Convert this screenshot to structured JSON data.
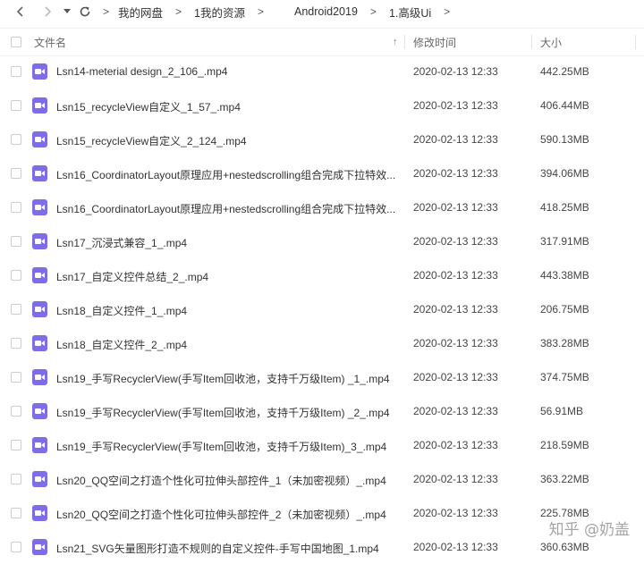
{
  "toolbar": {
    "breadcrumbs": [
      "我的网盘",
      "1我的资源",
      "Android2019",
      "1.高级Ui"
    ],
    "separator": ">"
  },
  "header": {
    "name": "文件名",
    "modified": "修改时间",
    "size": "大小"
  },
  "files": [
    {
      "name": "Lsn14-meterial design_2_106_.mp4",
      "date": "2020-02-13 12:33",
      "size": "442.25MB"
    },
    {
      "name": "Lsn15_recycleView自定义_1_57_.mp4",
      "date": "2020-02-13 12:33",
      "size": "406.44MB"
    },
    {
      "name": "Lsn15_recycleView自定义_2_124_.mp4",
      "date": "2020-02-13 12:33",
      "size": "590.13MB"
    },
    {
      "name": "Lsn16_CoordinatorLayout原理应用+nestedscrolling组合完成下拉特效...",
      "date": "2020-02-13 12:33",
      "size": "394.06MB"
    },
    {
      "name": "Lsn16_CoordinatorLayout原理应用+nestedscrolling组合完成下拉特效...",
      "date": "2020-02-13 12:33",
      "size": "418.25MB"
    },
    {
      "name": "Lsn17_沉浸式兼容_1_.mp4",
      "date": "2020-02-13 12:33",
      "size": "317.91MB"
    },
    {
      "name": "Lsn17_自定义控件总结_2_.mp4",
      "date": "2020-02-13 12:33",
      "size": "443.38MB"
    },
    {
      "name": "Lsn18_自定义控件_1_.mp4",
      "date": "2020-02-13 12:33",
      "size": "206.75MB"
    },
    {
      "name": "Lsn18_自定义控件_2_.mp4",
      "date": "2020-02-13 12:33",
      "size": "383.28MB"
    },
    {
      "name": "Lsn19_手写RecyclerView(手写Item回收池，支持千万级Item) _1_.mp4",
      "date": "2020-02-13 12:33",
      "size": "374.75MB"
    },
    {
      "name": "Lsn19_手写RecyclerView(手写Item回收池，支持千万级Item) _2_.mp4",
      "date": "2020-02-13 12:33",
      "size": "56.91MB"
    },
    {
      "name": "Lsn19_手写RecyclerView(手写Item回收池，支持千万级Item)_3_.mp4",
      "date": "2020-02-13 12:33",
      "size": "218.59MB"
    },
    {
      "name": "Lsn20_QQ空间之打造个性化可拉伸头部控件_1（未加密视频）_.mp4",
      "date": "2020-02-13 12:33",
      "size": "363.22MB"
    },
    {
      "name": "Lsn20_QQ空间之打造个性化可拉伸头部控件_2（未加密视频）_.mp4",
      "date": "2020-02-13 12:33",
      "size": "225.78MB"
    },
    {
      "name": "Lsn21_SVG矢量图形打造不规则的自定义控件-手写中国地图_1.mp4",
      "date": "2020-02-13 12:33",
      "size": "360.63MB"
    }
  ],
  "watermark": "知乎 @奶盖",
  "colors": {
    "accent": "#3a8ee6",
    "video_icon": "#7d6ee8"
  }
}
